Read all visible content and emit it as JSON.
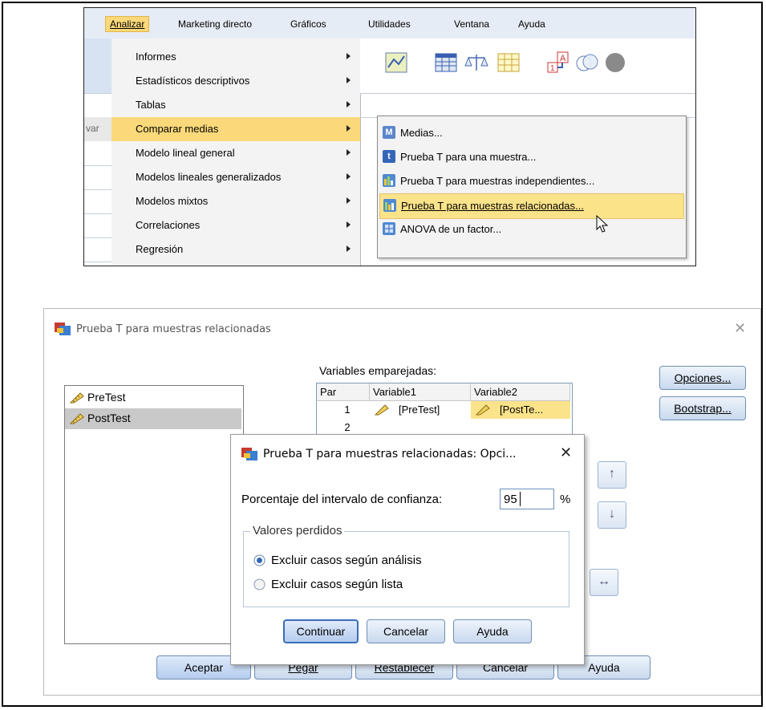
{
  "menubar": {
    "items": [
      "Analizar",
      "Marketing directo",
      "Gráficos",
      "Utilidades",
      "Ventana",
      "Ayuda"
    ]
  },
  "analizar_menu": {
    "items": [
      "Informes",
      "Estadísticos descriptivos",
      "Tablas",
      "Comparar medias",
      "Modelo lineal general",
      "Modelos lineales generalizados",
      "Modelos mixtos",
      "Correlaciones",
      "Regresión"
    ],
    "selected": "Comparar medias"
  },
  "data_strip": {
    "var_label": "var"
  },
  "comparar_submenu": {
    "items": [
      "Medias...",
      "Prueba T para una muestra...",
      "Prueba T para muestras independientes...",
      "Prueba T para muestras relacionadas...",
      "ANOVA de un factor..."
    ],
    "icons": [
      "M",
      "t",
      "",
      "",
      ""
    ],
    "selected": "Prueba T para muestras relacionadas..."
  },
  "dialog": {
    "title": "Prueba T para muestras relacionadas",
    "close": "✕",
    "source_vars": [
      "PreTest",
      "PostTest"
    ],
    "paired_label": "Variables emparejadas:",
    "table": {
      "headers": [
        "Par",
        "Variable1",
        "Variable2"
      ],
      "rows": [
        [
          "1",
          "[PreTest]",
          "[PostTe..."
        ],
        [
          "2",
          "",
          ""
        ]
      ]
    },
    "buttons_right": [
      "Opciones...",
      "Bootstrap..."
    ],
    "buttons_bottom": [
      "Aceptar",
      "Pegar",
      "Restablecer",
      "Cancelar",
      "Ayuda"
    ],
    "arrows": [
      "↑",
      "↓",
      "↔"
    ]
  },
  "options_dialog": {
    "title": "Prueba T para muestras relacionadas: Opci...",
    "close": "✕",
    "confidence_label": "Porcentaje del intervalo de confianza:",
    "confidence_value": "95",
    "percent": "%",
    "group_label": "Valores perdidos",
    "radios": [
      "Excluir casos según análisis",
      "Excluir casos según lista"
    ],
    "selected_radio": 0,
    "buttons": [
      "Continuar",
      "Cancelar",
      "Ayuda"
    ]
  },
  "colors": {
    "highlight": "#fbd97a",
    "menubar": "#e6ecf5",
    "button": "#c9d9ee"
  }
}
